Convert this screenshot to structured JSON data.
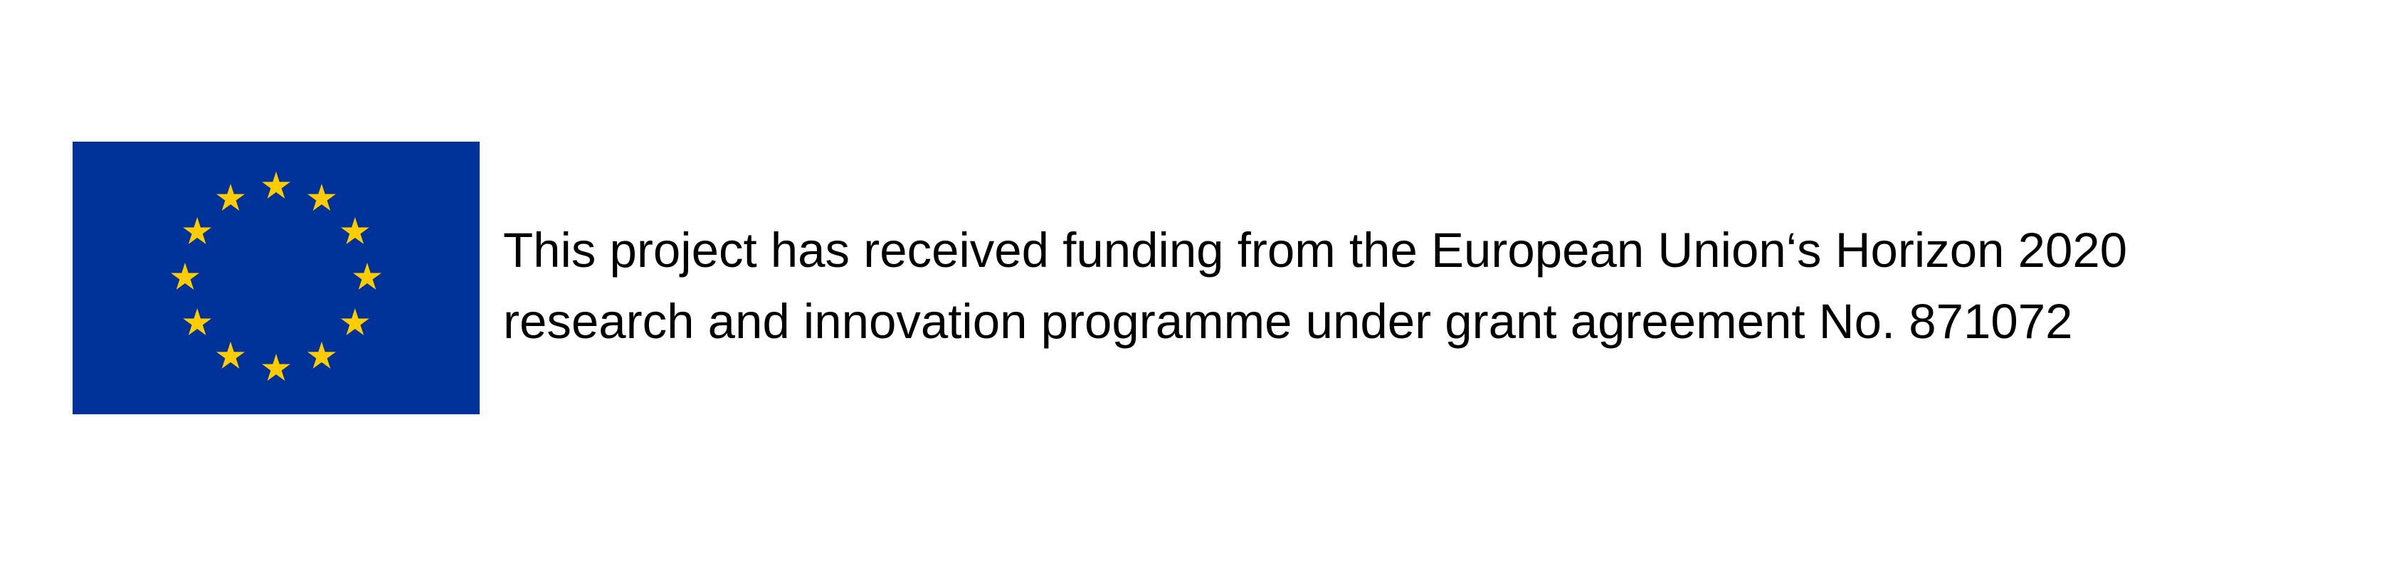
{
  "flag": {
    "icon": "eu-flag-icon",
    "background_color": "#003399",
    "star_color": "#FFCC00",
    "star_count": 12
  },
  "funding_statement": {
    "line1": "This project has received funding from the European Union‘s Horizon 2020",
    "line2": "research and innovation programme under grant agreement No. 871072"
  }
}
